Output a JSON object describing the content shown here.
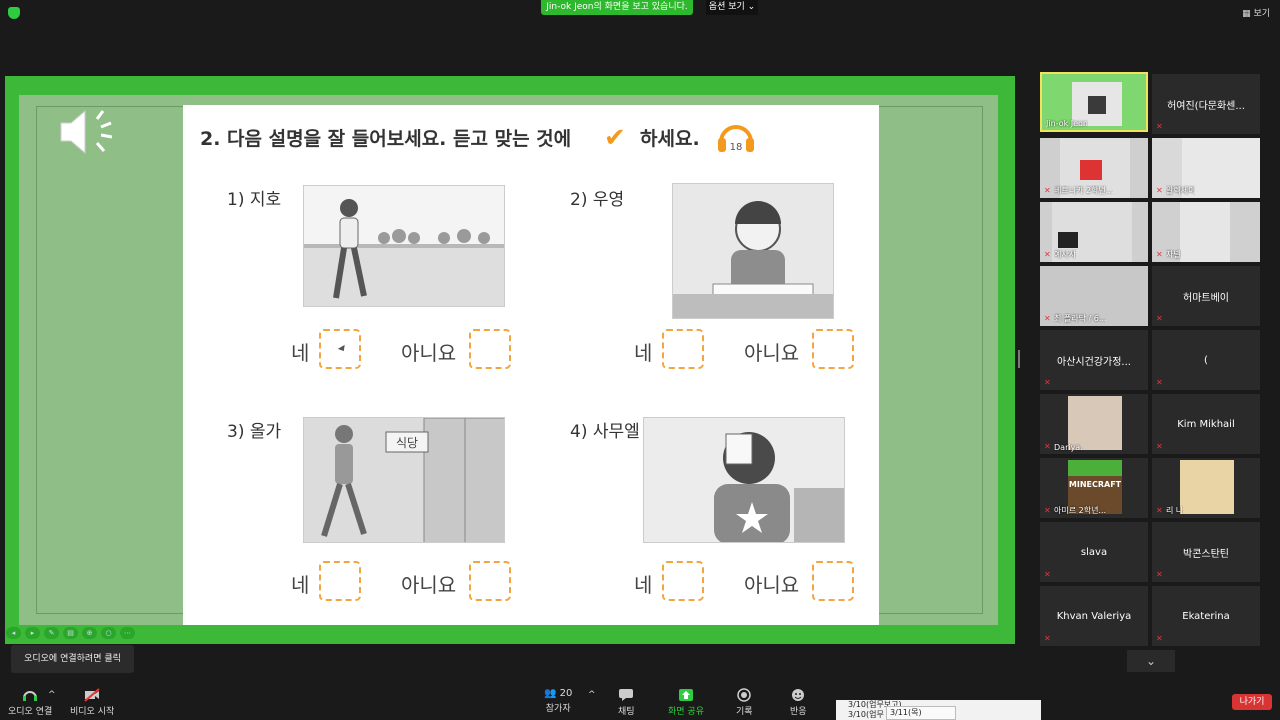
{
  "topbar": {
    "share_banner": "Jin-ok  Jeon의 화면을 보고 있습니다.",
    "options": "옵션 보기 ⌄",
    "view": "보기"
  },
  "worksheet": {
    "title": "2. 다음 설명을 잘 들어보세요. 듣고 맞는 것에",
    "title_end": "하세요.",
    "checkmark": "✔",
    "track_number": "18",
    "questions": [
      {
        "label": "1)  지호",
        "yes": "네",
        "no": "아니요"
      },
      {
        "label": "2)  우영",
        "yes": "네",
        "no": "아니요"
      },
      {
        "label": "3)  올가",
        "yes": "네",
        "no": "아니요"
      },
      {
        "label": "4)  사무엘",
        "yes": "네",
        "no": "아니요"
      }
    ],
    "sign_text": "식당"
  },
  "tooltip": "오디오에 연결하려면 클릭",
  "bottombar": {
    "audio": "오디오 연결",
    "video": "비디오 시작",
    "participants": "참가자",
    "participants_count": "20",
    "chat": "채팅",
    "share": "화면 공유",
    "record": "기록",
    "reactions": "반응",
    "leave": "나가기"
  },
  "popup": {
    "line1": "3/10(업무보고)",
    "line2": "3/10(업무",
    "line3": "3/11(목)"
  },
  "participants": [
    {
      "name": "Jin-ok Jeon",
      "type": "video"
    },
    {
      "name": "허여진(다문화센...",
      "type": "name"
    },
    {
      "name": "베트니카 2학년...",
      "type": "video"
    },
    {
      "name": "알렉세이",
      "type": "video"
    },
    {
      "name": "예사샤",
      "type": "video"
    },
    {
      "name": "자넬",
      "type": "video"
    },
    {
      "name": "최 플라닥 / 6...",
      "type": "video"
    },
    {
      "name": "허마트베이",
      "type": "name"
    },
    {
      "name": "아산시건강가정...",
      "type": "name"
    },
    {
      "name": "(",
      "type": "name"
    },
    {
      "name": "Dariya.",
      "type": "video"
    },
    {
      "name": "Kim Mikhail",
      "type": "name"
    },
    {
      "name": "아미르 2학년...",
      "type": "video"
    },
    {
      "name": "리 나",
      "type": "video"
    },
    {
      "name": "slava",
      "type": "name"
    },
    {
      "name": "박콘스탄틴",
      "type": "name"
    },
    {
      "name": "Khvan Valeriya",
      "type": "name"
    },
    {
      "name": "Ekaterina",
      "type": "name"
    }
  ],
  "minecraft_text": "MINECRAFT",
  "more_icon": "⌄"
}
